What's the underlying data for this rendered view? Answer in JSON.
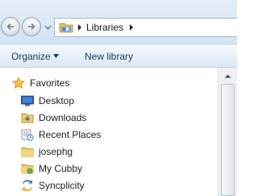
{
  "address_bar": {
    "breadcrumbs": [
      "Libraries"
    ]
  },
  "command_bar": {
    "organize_label": "Organize",
    "new_library_label": "New library"
  },
  "navigation_pane": {
    "favorites_label": "Favorites",
    "items": [
      {
        "label": "Desktop",
        "icon": "desktop-icon"
      },
      {
        "label": "Downloads",
        "icon": "downloads-folder-icon"
      },
      {
        "label": "Recent Places",
        "icon": "recent-places-icon"
      },
      {
        "label": "josephg",
        "icon": "folder-icon"
      },
      {
        "label": "My Cubby",
        "icon": "cubby-folder-icon"
      },
      {
        "label": "Syncplicity",
        "icon": "syncplicity-icon"
      }
    ]
  },
  "colors": {
    "nav_background": "#dbe8f5",
    "command_text": "#1e395b",
    "favorites_star": "#f0b400"
  }
}
